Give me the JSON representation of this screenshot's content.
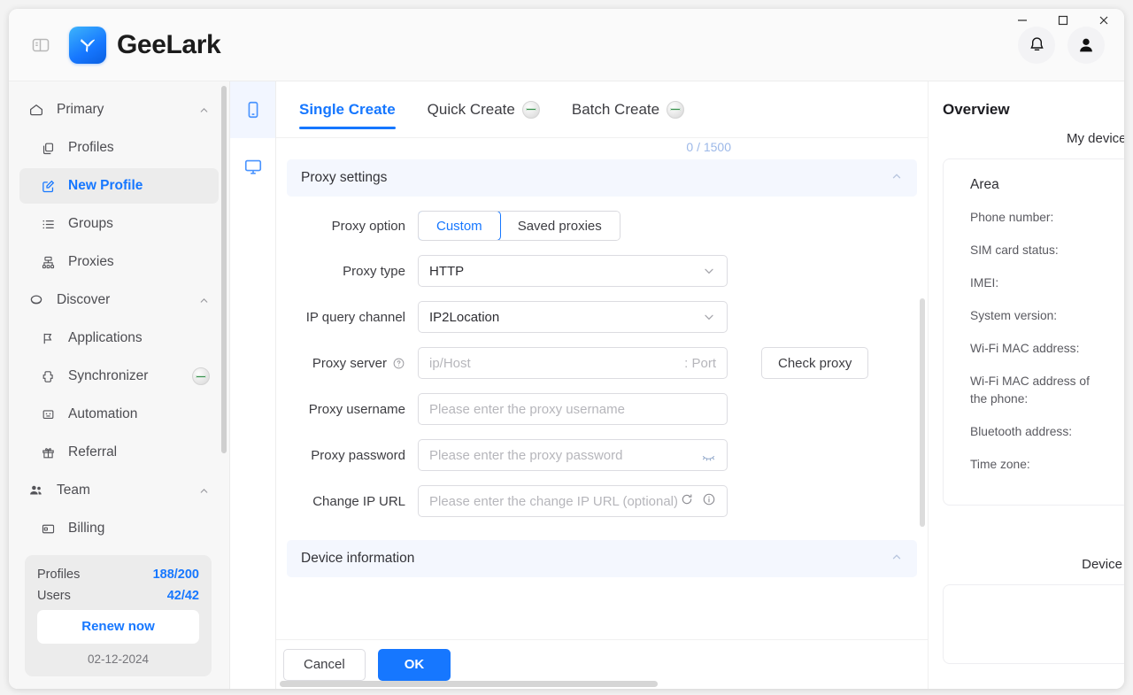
{
  "window": {
    "minimize_label": "Minimize",
    "maximize_label": "Maximize",
    "close_label": "Close"
  },
  "header": {
    "brand": "GeeLark",
    "panel_toggle_name": "panel-toggle-icon",
    "notification_icon": "bell-icon",
    "account_icon": "user-avatar-icon"
  },
  "sidebar": {
    "groups": [
      {
        "label": "Primary",
        "icon": "home-icon",
        "expanded": true,
        "items": [
          {
            "label": "Profiles",
            "icon": "profiles-icon",
            "active": false
          },
          {
            "label": "New Profile",
            "icon": "edit-square-icon",
            "active": true
          },
          {
            "label": "Groups",
            "icon": "list-icon",
            "active": false
          },
          {
            "label": "Proxies",
            "icon": "proxy-network-icon",
            "active": false
          }
        ]
      },
      {
        "label": "Discover",
        "icon": "discover-icon",
        "expanded": true,
        "items": [
          {
            "label": "Applications",
            "icon": "applications-icon",
            "active": false
          },
          {
            "label": "Synchronizer",
            "icon": "synchronizer-icon",
            "active": false,
            "toggle": true
          },
          {
            "label": "Automation",
            "icon": "automation-icon",
            "active": false
          },
          {
            "label": "Referral",
            "icon": "gift-icon",
            "active": false
          }
        ]
      },
      {
        "label": "Team",
        "icon": "team-icon",
        "expanded": true,
        "items": [
          {
            "label": "Billing",
            "icon": "billing-card-icon",
            "active": false
          }
        ]
      }
    ],
    "usage": {
      "profiles_label": "Profiles",
      "profiles_value": "188/200",
      "users_label": "Users",
      "users_value": "42/42",
      "renew_label": "Renew now",
      "date": "02-12-2024"
    }
  },
  "rail": {
    "items": [
      {
        "name": "phone-device-icon",
        "active": true
      },
      {
        "name": "desktop-device-icon",
        "active": false
      }
    ]
  },
  "main": {
    "tabs": [
      {
        "label": "Single Create",
        "active": true,
        "toggle": false
      },
      {
        "label": "Quick Create",
        "active": false,
        "toggle": true
      },
      {
        "label": "Batch Create",
        "active": false,
        "toggle": true
      }
    ],
    "counter": "0 / 1500",
    "proxy_section": {
      "title": "Proxy settings",
      "collapse_icon": "chevron-up-icon",
      "proxy_option": {
        "label": "Proxy option",
        "options": [
          "Custom",
          "Saved proxies"
        ],
        "selected": "Custom"
      },
      "proxy_type": {
        "label": "Proxy type",
        "value": "HTTP"
      },
      "ip_query_channel": {
        "label": "IP query channel",
        "value": "IP2Location"
      },
      "proxy_server": {
        "label": "Proxy server",
        "help_icon": "question-circle-icon",
        "host_placeholder": "ip/Host",
        "port_placeholder": ": Port",
        "check_button": "Check proxy"
      },
      "proxy_username": {
        "label": "Proxy username",
        "placeholder": "Please enter the proxy username"
      },
      "proxy_password": {
        "label": "Proxy password",
        "placeholder": "Please enter the proxy password",
        "eye_icon": "eye-off-icon"
      },
      "change_ip_url": {
        "label": "Change IP URL",
        "placeholder": "Please enter the change IP URL (optional)",
        "refresh_icon": "refresh-icon",
        "info_icon": "info-circle-icon"
      }
    },
    "device_section": {
      "title": "Device information",
      "collapse_icon": "chevron-up-icon"
    },
    "footer": {
      "cancel_label": "Cancel",
      "ok_label": "OK"
    }
  },
  "overview": {
    "title": "Overview",
    "my_devices_label": "My devices",
    "area_label": "Area",
    "fields": [
      "Phone number:",
      "SIM card status:",
      "IMEI:",
      "System version:",
      "Wi-Fi MAC address:",
      "Wi-Fi MAC address of the phone:",
      "Bluetooth address:",
      "Time zone:"
    ],
    "device_charge_label": "Device charge"
  },
  "colors": {
    "accent": "#1677ff",
    "sidebar_bg": "#f7f7f7",
    "section_bg": "#f4f7fe"
  }
}
